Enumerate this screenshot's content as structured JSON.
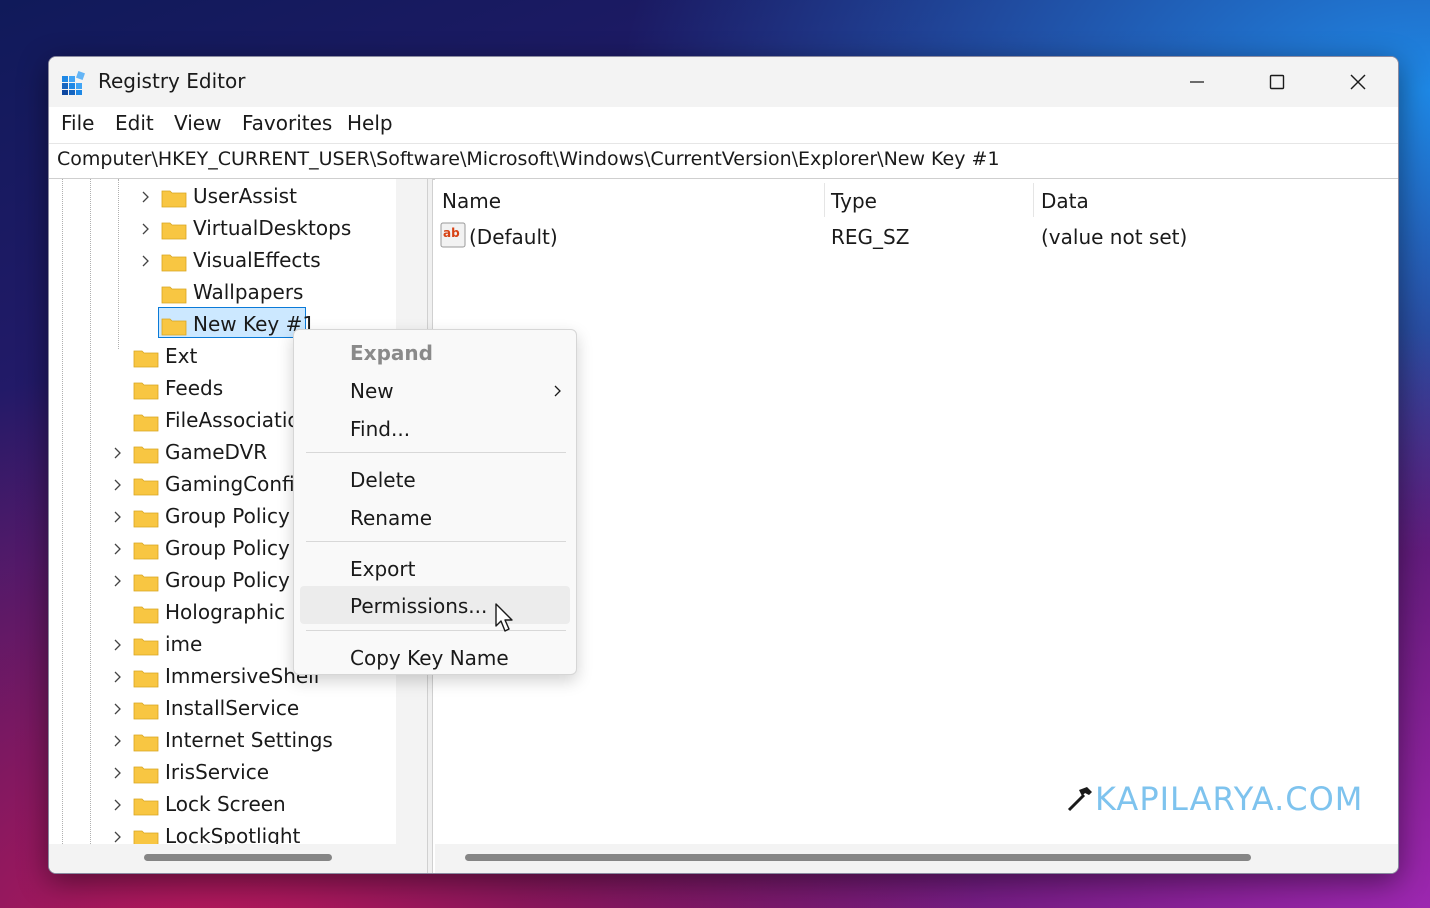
{
  "window": {
    "title": "Registry Editor",
    "controls": {
      "minimize": "minimize-icon",
      "maximize": "maximize-icon",
      "close": "close-icon"
    }
  },
  "menubar": [
    "File",
    "Edit",
    "View",
    "Favorites",
    "Help"
  ],
  "address": "Computer\\HKEY_CURRENT_USER\\Software\\Microsoft\\Windows\\CurrentVersion\\Explorer\\New Key #1",
  "tree": {
    "items": [
      {
        "label": "UserAssist",
        "expandable": true
      },
      {
        "label": "VirtualDesktops",
        "expandable": true
      },
      {
        "label": "VisualEffects",
        "expandable": true
      },
      {
        "label": "Wallpapers",
        "expandable": false
      },
      {
        "label": "New Key #1",
        "expandable": false,
        "selected": true
      },
      {
        "label": "Ext",
        "expandable": false
      },
      {
        "label": "Feeds",
        "expandable": false
      },
      {
        "label": "FileAssociation",
        "expandable": false
      },
      {
        "label": "GameDVR",
        "expandable": true
      },
      {
        "label": "GamingConfig",
        "expandable": true
      },
      {
        "label": "Group Policy",
        "expandable": true
      },
      {
        "label": "Group Policy E",
        "expandable": true
      },
      {
        "label": "Group Policy O",
        "expandable": true
      },
      {
        "label": "Holographic",
        "expandable": false
      },
      {
        "label": "ime",
        "expandable": true
      },
      {
        "label": "ImmersiveShell",
        "expandable": true
      },
      {
        "label": "InstallService",
        "expandable": true
      },
      {
        "label": "Internet Settings",
        "expandable": true
      },
      {
        "label": "IrisService",
        "expandable": true
      },
      {
        "label": "Lock Screen",
        "expandable": true
      },
      {
        "label": "LockSpotlight",
        "expandable": true
      }
    ]
  },
  "list": {
    "columns": [
      "Name",
      "Type",
      "Data"
    ],
    "rows": [
      {
        "icon": "string-value-icon",
        "name": "(Default)",
        "type": "REG_SZ",
        "data": "(value not set)"
      }
    ]
  },
  "context_menu": {
    "items": [
      {
        "label": "Expand",
        "disabled": true
      },
      {
        "label": "New",
        "submenu": true
      },
      {
        "label": "Find..."
      },
      {
        "label": "Delete"
      },
      {
        "label": "Rename"
      },
      {
        "label": "Export"
      },
      {
        "label": "Permissions...",
        "hovered": true
      },
      {
        "label": "Copy Key Name"
      }
    ]
  },
  "watermark": "KAPILARYA.COM",
  "colors": {
    "folder": "#f8c642",
    "selection": "#cce8ff",
    "selection_border": "#0a7ad8",
    "watermark": "#7ec3ee"
  }
}
